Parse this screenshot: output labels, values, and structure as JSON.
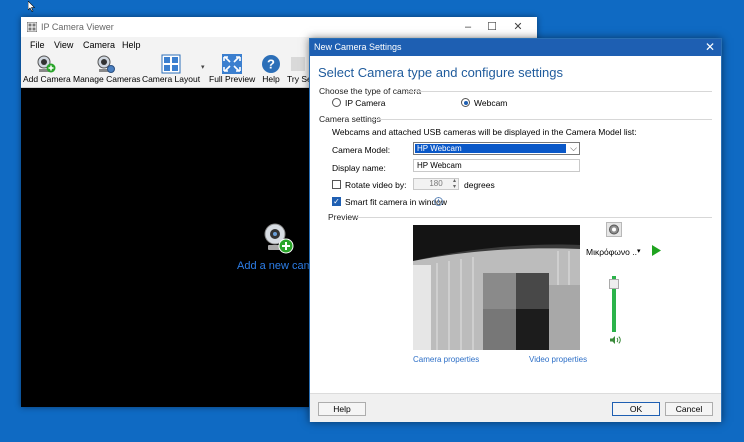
{
  "main_window": {
    "title": "IP Camera Viewer",
    "menu": [
      "File",
      "View",
      "Camera",
      "Help"
    ],
    "toolbar": {
      "add_camera": "Add Camera",
      "manage_cameras": "Manage Cameras",
      "camera_layout": "Camera Layout",
      "full_preview": "Full Preview",
      "help": "Help",
      "try": "Try Se"
    },
    "add_new_camera_text": "Add a new came"
  },
  "dialog": {
    "title": "New Camera Settings",
    "heading": "Select Camera type and configure settings",
    "camera_type_section": "Choose the type of camera",
    "type_options": [
      "IP Camera",
      "Webcam"
    ],
    "selected_type": "Webcam",
    "camera_settings_section": "Camera settings",
    "info_text": "Webcams and attached USB cameras will be displayed in the Camera Model list:",
    "camera_model_label": "Camera Model:",
    "camera_model_value": "HP Webcam",
    "display_name_label": "Display name:",
    "display_name_value": "HP Webcam",
    "rotate_label": "Rotate video by:",
    "rotate_checked": false,
    "rotate_value": "180",
    "rotate_unit": "degrees",
    "smart_fit_label": "Smart fit camera in window",
    "smart_fit_checked": true,
    "preview_section": "Preview",
    "microphone_label": "Μικρόφωνο ..",
    "camera_properties": "Camera properties",
    "video_properties": "Video properties",
    "help_button": "Help",
    "ok_button": "OK",
    "cancel_button": "Cancel"
  },
  "colors": {
    "accent": "#1e5fb2",
    "desktop": "#0f6ac3",
    "link": "#2d6fc7",
    "play": "#1fa31f"
  }
}
